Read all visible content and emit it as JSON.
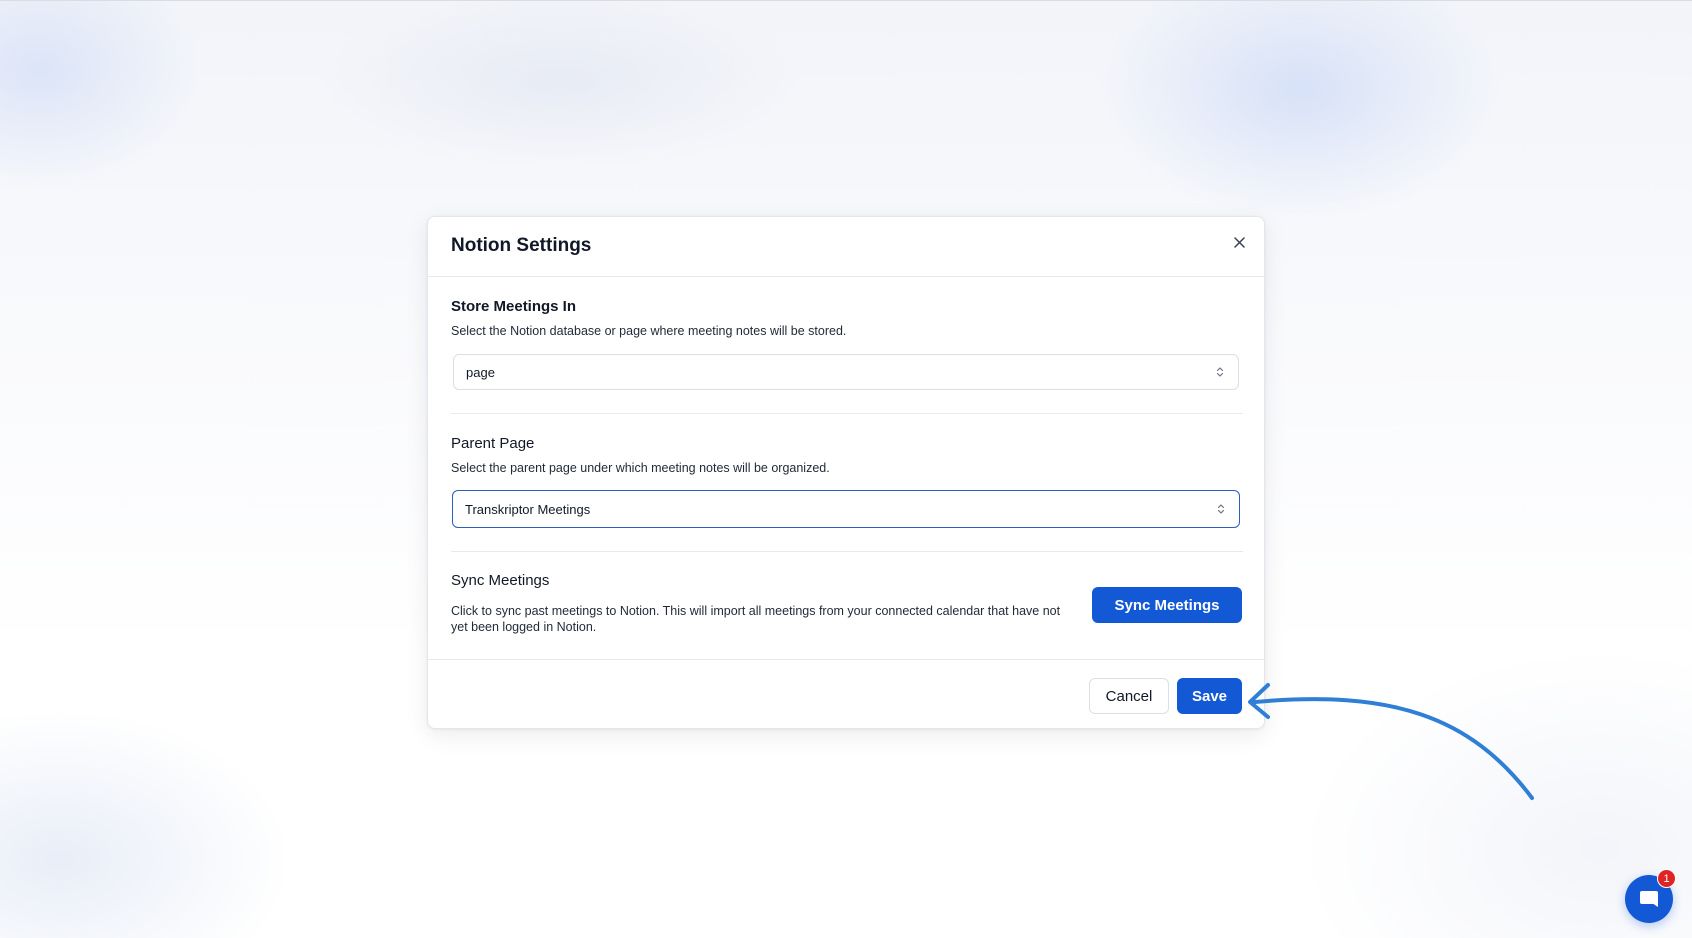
{
  "modal": {
    "title": "Notion Settings",
    "store_section": {
      "label": "Store Meetings In",
      "description": "Select the Notion database or page where meeting notes will be stored.",
      "selected_value": "page"
    },
    "parent_section": {
      "label": "Parent Page",
      "description": "Select the parent page under which meeting notes will be organized.",
      "selected_value": "Transkriptor Meetings"
    },
    "sync_section": {
      "label": "Sync Meetings",
      "description": "Click to sync past meetings to Notion. This will import all meetings from your connected calendar that have not yet been logged in Notion.",
      "button_label": "Sync Meetings"
    },
    "footer": {
      "cancel_label": "Cancel",
      "save_label": "Save"
    }
  },
  "chat_widget": {
    "badge_count": "1"
  },
  "colors": {
    "primary": "#1359d6",
    "focus_border": "#2b5fb8",
    "annotation_arrow": "#2f7fd6",
    "badge": "#e02424"
  },
  "icons": {
    "close": "close-icon",
    "select_chevron": "chevron-up-down-icon",
    "chat": "chat-bubble-icon",
    "annotation": "curved-arrow-icon"
  }
}
